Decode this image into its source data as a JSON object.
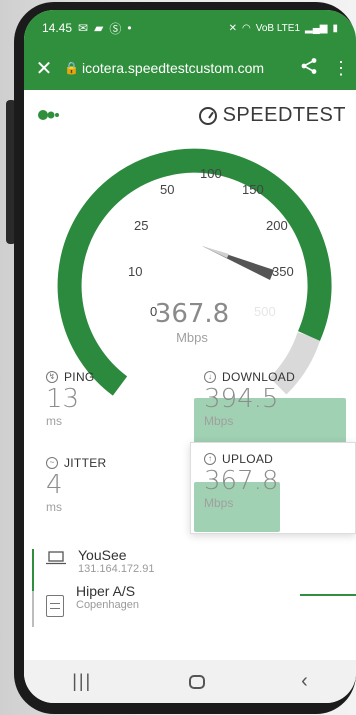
{
  "status_bar": {
    "time": "14.45",
    "left_icons": [
      "mail-icon",
      "message-icon",
      "s-icon",
      "dot-icon"
    ],
    "right_icons": [
      "mute-icon",
      "wifi-icon",
      "volte-icon",
      "signal-icon",
      "battery-icon"
    ],
    "network_label": "VoB LTE1"
  },
  "browser": {
    "url": "icotera.speedtestcustom.com",
    "close_icon": "close-icon",
    "lock_icon": "lock-icon",
    "share_icon": "share-icon",
    "more_icon": "more-vert-icon",
    "bar_color": "#2f8f3c"
  },
  "brand": {
    "name": "SPEEDTEST"
  },
  "gauge": {
    "ticks": [
      "0",
      "10",
      "25",
      "50",
      "100",
      "150",
      "200",
      "350",
      "500"
    ],
    "value": "367.8",
    "unit": "Mbps",
    "max_label": "500",
    "needle_value": 367.8,
    "arc_color": "#2b8a3e",
    "track_color": "#d9d9d9"
  },
  "metrics": {
    "ping": {
      "label": "PING",
      "value": "13",
      "unit": "ms"
    },
    "jitter": {
      "label": "JITTER",
      "value": "4",
      "unit": "ms"
    },
    "download": {
      "label": "DOWNLOAD",
      "value": "394.5",
      "unit": "Mbps"
    },
    "upload": {
      "label": "UPLOAD",
      "value": "367.8",
      "unit": "Mbps"
    }
  },
  "connection": {
    "isp": {
      "name": "YouSee",
      "ip": "131.164.172.91"
    },
    "server": {
      "name": "Hiper A/S",
      "location": "Copenhagen"
    }
  },
  "nav": {
    "recents_icon": "recents-icon",
    "home_icon": "home-icon",
    "back_icon": "back-icon"
  }
}
